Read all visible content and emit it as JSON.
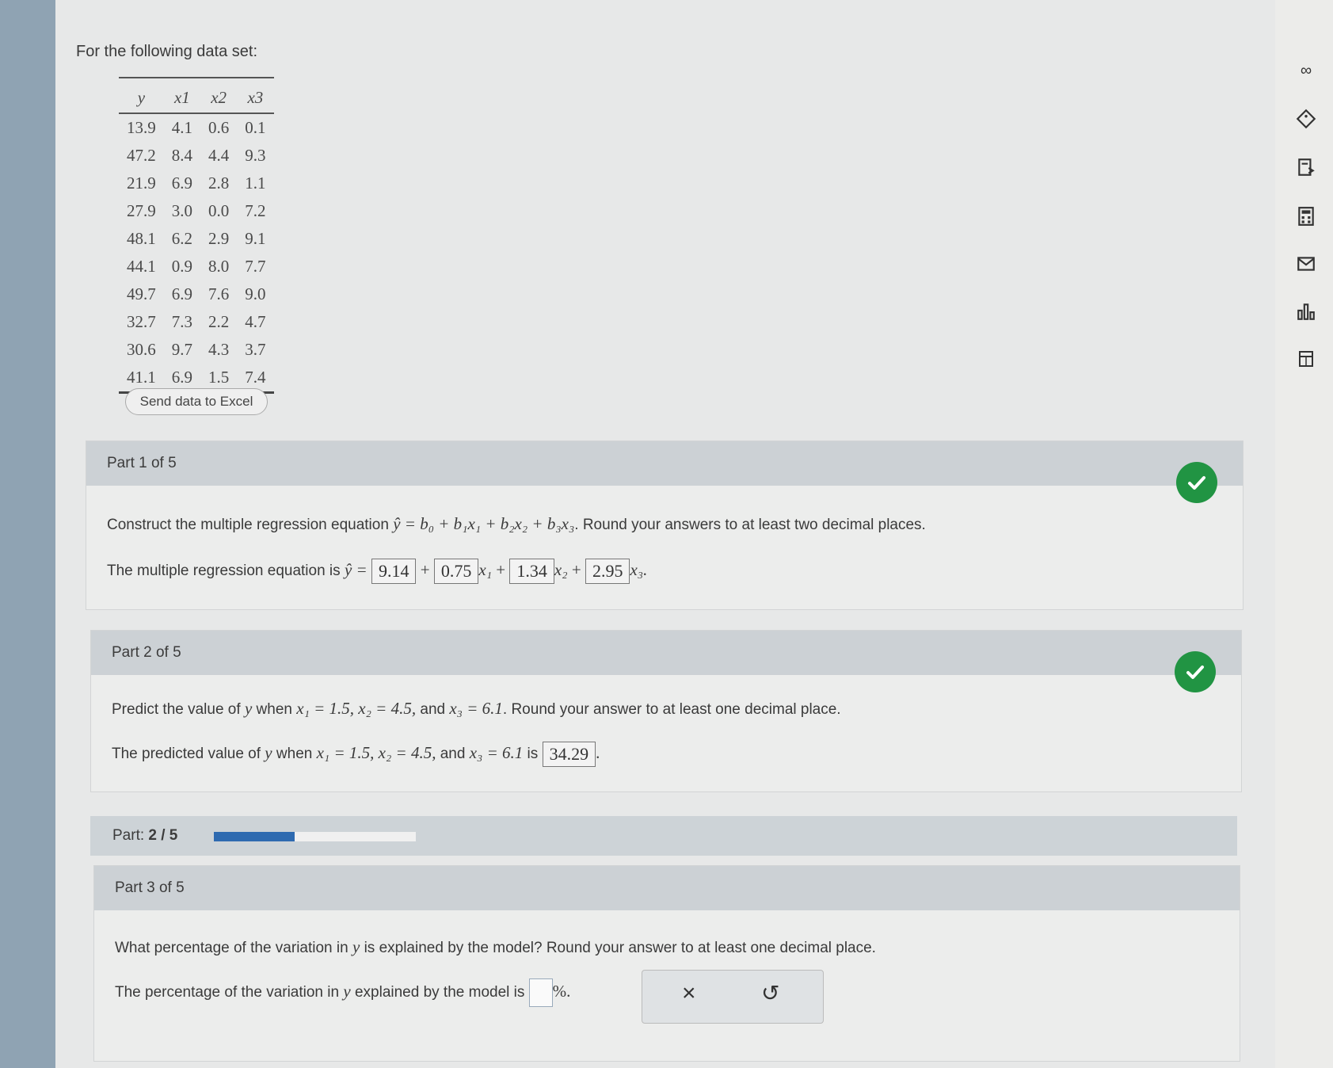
{
  "intro_text": "For the following data set:",
  "table": {
    "headers": [
      "y",
      "x1",
      "x2",
      "x3"
    ],
    "rows": [
      [
        "13.9",
        "4.1",
        "0.6",
        "0.1"
      ],
      [
        "47.2",
        "8.4",
        "4.4",
        "9.3"
      ],
      [
        "21.9",
        "6.9",
        "2.8",
        "1.1"
      ],
      [
        "27.9",
        "3.0",
        "0.0",
        "7.2"
      ],
      [
        "48.1",
        "6.2",
        "2.9",
        "9.1"
      ],
      [
        "44.1",
        "0.9",
        "8.0",
        "7.7"
      ],
      [
        "49.7",
        "6.9",
        "7.6",
        "9.0"
      ],
      [
        "32.7",
        "7.3",
        "2.2",
        "4.7"
      ],
      [
        "30.6",
        "9.7",
        "4.3",
        "3.7"
      ],
      [
        "41.1",
        "6.9",
        "1.5",
        "7.4"
      ]
    ]
  },
  "send_excel_label": "Send data to Excel",
  "part1": {
    "header": "Part 1 of 5",
    "question_prefix": "Construct the multiple regression equation",
    "equation": "ŷ = b₀ + b₁x₁ + b₂x₂ + b₃x₃",
    "question_suffix": ". Round your answers to at least two decimal places.",
    "answer_prefix": "The multiple regression equation is",
    "yhat": "ŷ =",
    "b0": "9.14",
    "b1": "0.75",
    "b2": "1.34",
    "b3": "2.95",
    "status": "correct"
  },
  "part2": {
    "header": "Part 2 of 5",
    "question_a": "Predict the value of",
    "question_b": "when",
    "question_vals": "x₁ = 1.5,  x₂ = 4.5,",
    "question_and": "and",
    "question_x3": "x₃ = 6.1",
    "question_suffix": ". Round your answer to at least one decimal place.",
    "answer_a": "The predicted value of",
    "answer_b": "when",
    "answer_vals": "x₁ = 1.5,  x₂ = 4.5,",
    "answer_and": "and",
    "answer_x3": "x₃ = 6.1",
    "answer_is": "is",
    "answer_value": "34.29",
    "status": "correct"
  },
  "progress": {
    "label": "Part:",
    "value": "2 / 5",
    "fraction": 0.4,
    "color": "#2e6ab0"
  },
  "part3": {
    "header": "Part 3 of 5",
    "question_a": "What percentage of the variation in",
    "question_b": "is explained by the model? Round your answer to at least one decimal place.",
    "answer_a": "The percentage of the variation in",
    "answer_b": "explained by the model is",
    "answer_suffix": "%.",
    "answer_value": ""
  },
  "var_y": "y",
  "action_clear": "×",
  "action_undo": "↺",
  "right_icons": [
    "infinity-icon",
    "tag-icon",
    "book-icon",
    "calculator-icon",
    "mail-icon",
    "chart-icon",
    "data-icon"
  ],
  "accent_green": "#219443"
}
